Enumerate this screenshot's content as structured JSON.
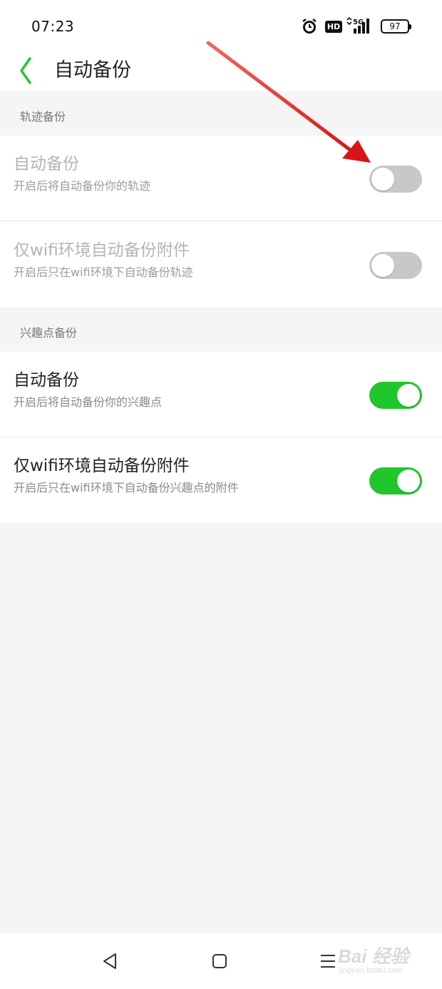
{
  "status_bar": {
    "time": "07:23",
    "hd_label": "HD",
    "network_label": "5G",
    "battery": "97"
  },
  "header": {
    "title": "自动备份",
    "back_icon": "chevron-left-icon",
    "accent_color": "#1fc72a"
  },
  "sections": [
    {
      "label": "轨迹备份",
      "items": [
        {
          "title": "自动备份",
          "description": "开启后将自动备份你的轨迹",
          "enabled": false,
          "toggle_on": false
        },
        {
          "title": "仅wifi环境自动备份附件",
          "description": "开启后只在wifi环境下自动备份轨迹",
          "enabled": false,
          "toggle_on": false
        }
      ]
    },
    {
      "label": "兴趣点备份",
      "items": [
        {
          "title": "自动备份",
          "description": "开启后将自动备份你的兴趣点",
          "enabled": true,
          "toggle_on": true
        },
        {
          "title": "仅wifi环境自动备份附件",
          "description": "开启后只在wifi环境下自动备份兴趣点的附件",
          "enabled": true,
          "toggle_on": true
        }
      ]
    }
  ],
  "colors": {
    "toggle_on": "#1fc72a",
    "toggle_off": "#c8c8c8",
    "annotation_arrow": "#e0201f"
  },
  "nav_bar": {
    "icons": [
      "triangle-back-icon",
      "square-home-icon",
      "menu-lines-icon"
    ]
  },
  "watermark": {
    "logo": "Bai 经验",
    "url": "jingyan.baidu.com"
  }
}
